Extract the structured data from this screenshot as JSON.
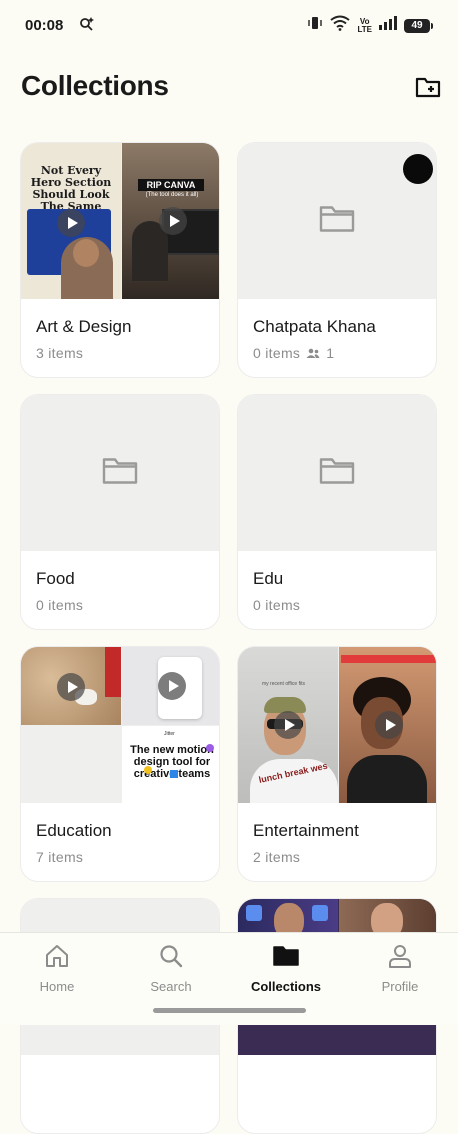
{
  "status_bar": {
    "time": "00:08",
    "network_label": "Vo\nLTE",
    "battery": "49"
  },
  "header": {
    "title": "Collections"
  },
  "collections": [
    {
      "name": "Art & Design",
      "count": "3 items",
      "thumb_text_1": "Not Every Hero Section Should Look The Same",
      "thumb_text_2": "RIP CANVA",
      "thumb_text_3": "(The tool does it all)"
    },
    {
      "name": "Chatpata Khana",
      "count": "0 items",
      "members": "1"
    },
    {
      "name": "Food",
      "count": "0 items"
    },
    {
      "name": "Edu",
      "count": "0 items"
    },
    {
      "name": "Education",
      "count": "7 items",
      "thumb_text_1": "The new motion design tool for creative teams",
      "thumb_text_2": "Jitter"
    },
    {
      "name": "Entertainment",
      "count": "2 items",
      "thumb_text_1": "my recent office fits",
      "thumb_text_2": "lunch break wes"
    }
  ],
  "nav": {
    "items": [
      {
        "label": "Home",
        "icon": "home-icon"
      },
      {
        "label": "Search",
        "icon": "search-icon"
      },
      {
        "label": "Collections",
        "icon": "folder-icon"
      },
      {
        "label": "Profile",
        "icon": "person-icon"
      }
    ],
    "active": "Collections"
  },
  "colors": {
    "background": "#fcfcf5",
    "card": "#ffffff",
    "placeholder": "#efefed",
    "muted_text": "#8c8c8c"
  }
}
